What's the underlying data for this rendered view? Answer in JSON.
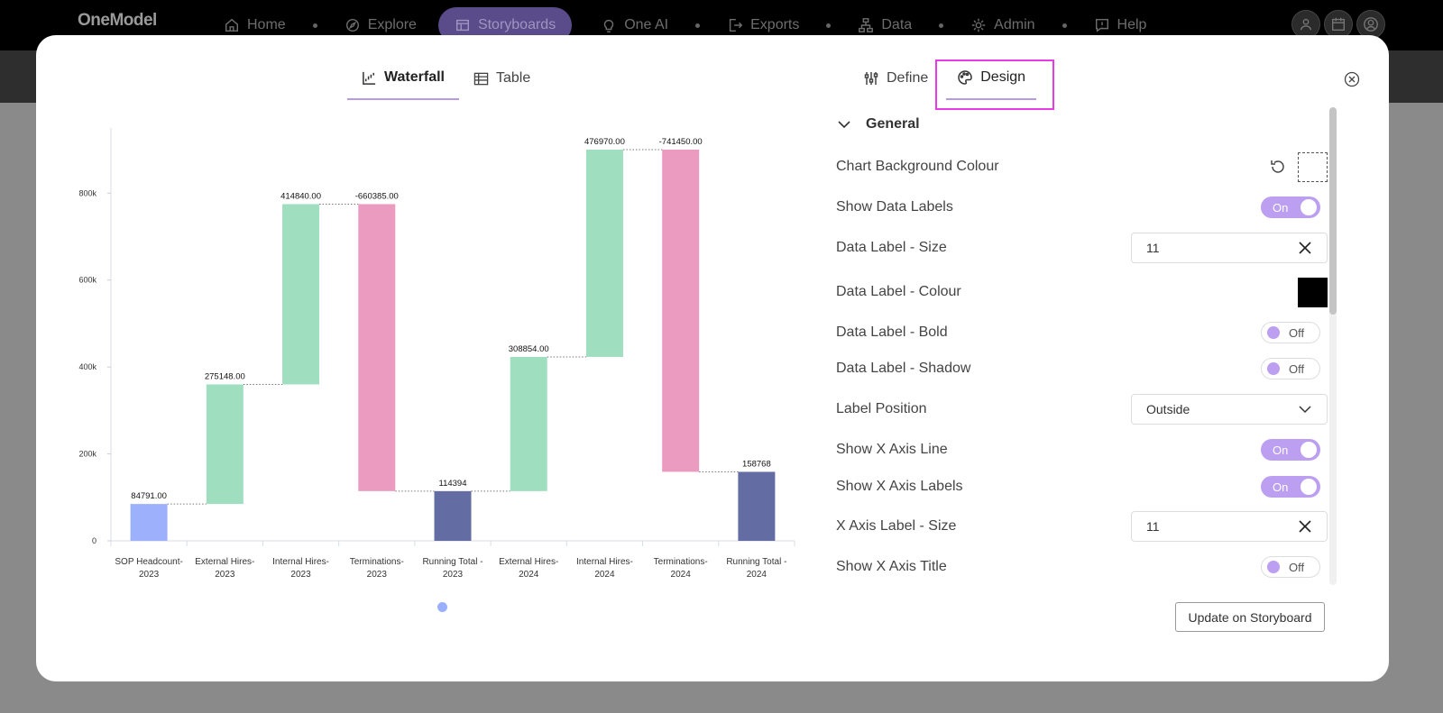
{
  "nav": {
    "logo": "OneModel",
    "items": [
      {
        "label": "Home",
        "icon": "home-icon"
      },
      {
        "label": "Explore",
        "icon": "compass-icon"
      },
      {
        "label": "Storyboards",
        "icon": "storyboard-icon"
      },
      {
        "label": "One AI",
        "icon": "lightbulb-icon"
      },
      {
        "label": "Exports",
        "icon": "export-icon"
      },
      {
        "label": "Data",
        "icon": "hierarchy-icon"
      },
      {
        "label": "Admin",
        "icon": "gear-icon"
      },
      {
        "label": "Help",
        "icon": "help-chat-icon"
      }
    ],
    "active": "Storyboards"
  },
  "view_tabs": [
    {
      "label": "Waterfall",
      "active": true
    },
    {
      "label": "Table",
      "active": false
    }
  ],
  "panel_tabs": [
    {
      "label": "Define",
      "active": false
    },
    {
      "label": "Design",
      "active": true
    }
  ],
  "settings": {
    "section": "General",
    "chart_bg_label": "Chart Background Colour",
    "show_data_labels": {
      "label": "Show Data Labels",
      "value": "On"
    },
    "data_label_size": {
      "label": "Data Label - Size",
      "value": "11"
    },
    "data_label_colour": {
      "label": "Data Label - Colour",
      "color": "#000000"
    },
    "data_label_bold": {
      "label": "Data Label - Bold",
      "value": "Off"
    },
    "data_label_shadow": {
      "label": "Data Label - Shadow",
      "value": "Off"
    },
    "label_position": {
      "label": "Label Position",
      "value": "Outside"
    },
    "show_x_axis_line": {
      "label": "Show X Axis Line",
      "value": "On"
    },
    "show_x_axis_labels": {
      "label": "Show X Axis Labels",
      "value": "On"
    },
    "x_axis_label_size": {
      "label": "X Axis Label - Size",
      "value": "11"
    },
    "show_x_axis_title": {
      "label": "Show X Axis Title",
      "value": "Off"
    }
  },
  "update_button": "Update on Storyboard",
  "chart_data": {
    "type": "bar",
    "subtype": "waterfall",
    "ylim": [
      0,
      950000
    ],
    "yticks": [
      0,
      200000,
      400000,
      600000,
      800000
    ],
    "ytick_labels": [
      "0",
      "200k",
      "400k",
      "600k",
      "800k"
    ],
    "grid": false,
    "categories": [
      [
        "SOP Headcount-",
        "2023"
      ],
      [
        "External Hires-",
        "2023"
      ],
      [
        "Internal Hires-",
        "2023"
      ],
      [
        "Terminations-",
        "2023"
      ],
      [
        "Running Total -",
        "2023"
      ],
      [
        "External Hires-",
        "2024"
      ],
      [
        "Internal Hires-",
        "2024"
      ],
      [
        "Terminations-",
        "2024"
      ],
      [
        "Running Total -",
        "2024"
      ]
    ],
    "bars": [
      {
        "start": 0,
        "end": 84791,
        "label": "84791.00",
        "kind": "start"
      },
      {
        "start": 84791,
        "end": 359939,
        "label": "275148.00",
        "kind": "increase"
      },
      {
        "start": 359939,
        "end": 774779,
        "label": "414840.00",
        "kind": "increase"
      },
      {
        "start": 774779,
        "end": 114394,
        "label": "-660385.00",
        "kind": "decrease"
      },
      {
        "start": 0,
        "end": 114394,
        "label": "114394",
        "kind": "total"
      },
      {
        "start": 114394,
        "end": 423248,
        "label": "308854.00",
        "kind": "increase"
      },
      {
        "start": 423248,
        "end": 900218,
        "label": "476970.00",
        "kind": "increase"
      },
      {
        "start": 900218,
        "end": 158768,
        "label": "-741450.00",
        "kind": "decrease"
      },
      {
        "start": 0,
        "end": 158768,
        "label": "158768",
        "kind": "total"
      }
    ],
    "colors": {
      "start": "#9db0fb",
      "increase": "#9fdfc0",
      "decrease": "#ec9bc0",
      "total": "#636ca3"
    }
  }
}
